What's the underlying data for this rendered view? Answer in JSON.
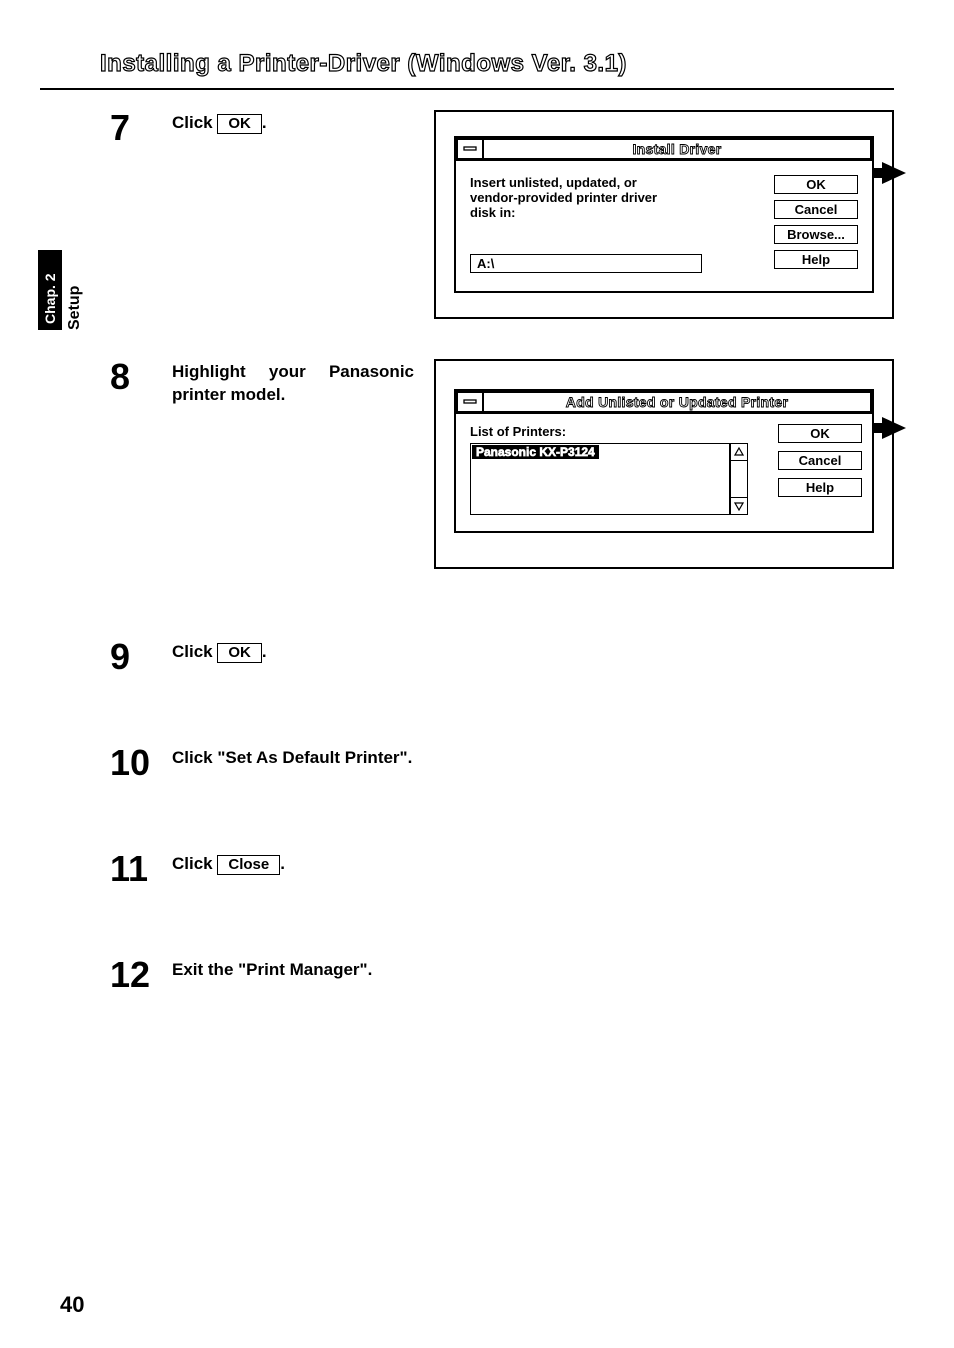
{
  "page": {
    "title": "Installing a Printer-Driver (Windows Ver. 3.1)",
    "number": "40",
    "side_tab": {
      "chapter": "Chap. 2",
      "section": "Setup"
    }
  },
  "steps": {
    "s7": {
      "num": "7",
      "pre": "Click ",
      "btn": "OK",
      "post": "."
    },
    "s8": {
      "num": "8",
      "text": "Highlight your Panasonic printer model."
    },
    "s9": {
      "num": "9",
      "pre": "Click ",
      "btn": "OK",
      "post": "."
    },
    "s10": {
      "num": "10",
      "text": "Click \"Set As Default Printer\"."
    },
    "s11": {
      "num": "11",
      "pre": "Click ",
      "btn": "Close",
      "post": "."
    },
    "s12": {
      "num": "12",
      "text": "Exit the \"Print Manager\"."
    }
  },
  "dialog1": {
    "title": "Install Driver",
    "message": "Insert unlisted, updated, or vendor-provided printer driver disk in:",
    "path_value": "A:\\",
    "buttons": {
      "ok": "OK",
      "cancel": "Cancel",
      "browse": "Browse...",
      "help": "Help"
    }
  },
  "dialog2": {
    "title": "Add Unlisted or Updated Printer",
    "list_label": "List of Printers:",
    "selected_item": "Panasonic KX-P3124",
    "buttons": {
      "ok": "OK",
      "cancel": "Cancel",
      "help": "Help"
    }
  }
}
